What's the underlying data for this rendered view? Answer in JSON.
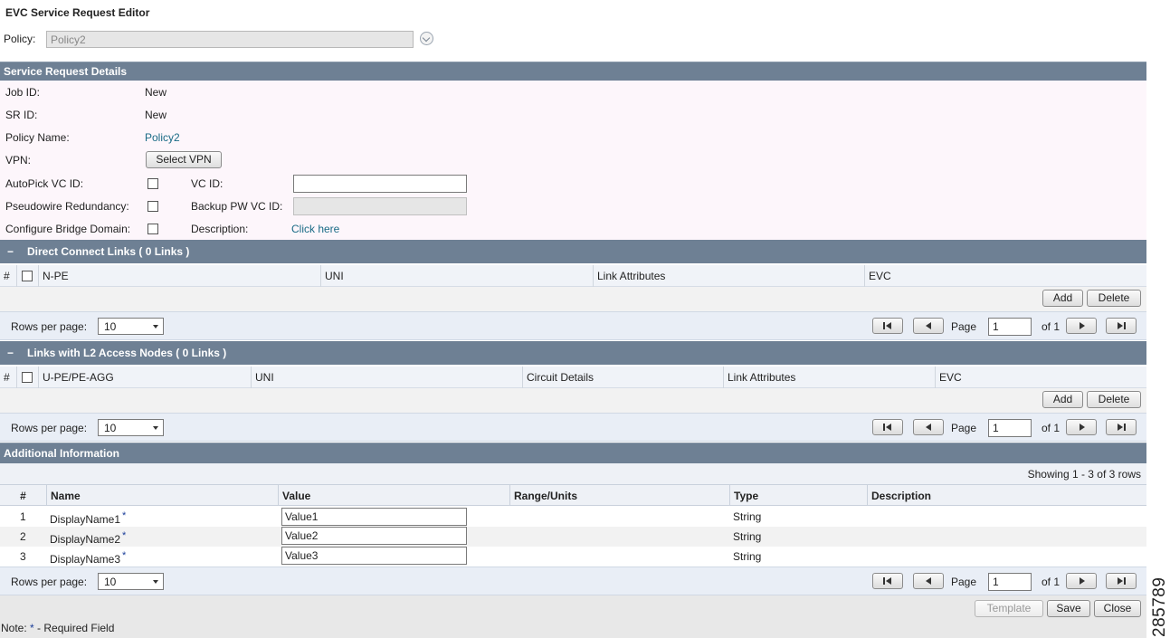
{
  "window": {
    "title": "EVC Service Request Editor"
  },
  "policy": {
    "label": "Policy:",
    "value": "Policy2"
  },
  "service_request_details": {
    "header": "Service Request Details",
    "job_id": {
      "label": "Job ID:",
      "value": "New"
    },
    "sr_id": {
      "label": "SR ID:",
      "value": "New"
    },
    "policy_name": {
      "label": "Policy Name:",
      "value": "Policy2"
    },
    "vpn": {
      "label": "VPN:",
      "button": "Select VPN"
    },
    "autopick_vc_id": {
      "label": "AutoPick VC ID:",
      "checked": false
    },
    "vc_id": {
      "label": "VC ID:",
      "value": ""
    },
    "pseudowire_redundancy": {
      "label": "Pseudowire Redundancy:",
      "checked": false
    },
    "backup_pw_vc_id": {
      "label": "Backup PW VC ID:",
      "value": ""
    },
    "configure_bridge_domain": {
      "label": "Configure Bridge Domain:",
      "checked": false
    },
    "description": {
      "label": "Description:",
      "link": "Click here"
    }
  },
  "direct_connect_links": {
    "toggle": "−",
    "header": "Direct Connect Links  ( 0 Links )",
    "columns": [
      "#",
      "N-PE",
      "UNI",
      "Link Attributes",
      "EVC"
    ],
    "add": "Add",
    "delete": "Delete"
  },
  "l2_access_links": {
    "toggle": "−",
    "header": "Links with L2 Access Nodes  ( 0 Links )",
    "columns": [
      "#",
      "U-PE/PE-AGG",
      "UNI",
      "Circuit Details",
      "Link Attributes",
      "EVC"
    ],
    "add": "Add",
    "delete": "Delete"
  },
  "pager": {
    "rows_per_page_label": "Rows per page:",
    "rows_per_page_value": "10",
    "page_label": "Page",
    "page_value": "1",
    "of_label": "of 1"
  },
  "additional_information": {
    "header": "Additional Information",
    "showing": "Showing 1 - 3 of 3 rows",
    "columns": [
      "#",
      "Name",
      "Value",
      "Range/Units",
      "Type",
      "Description"
    ],
    "rows": [
      {
        "num": "1",
        "name": "DisplayName1",
        "value": "Value1",
        "range": "",
        "type": "String",
        "description": ""
      },
      {
        "num": "2",
        "name": "DisplayName2",
        "value": "Value2",
        "range": "",
        "type": "String",
        "description": ""
      },
      {
        "num": "3",
        "name": "DisplayName3",
        "value": "Value3",
        "range": "",
        "type": "String",
        "description": ""
      }
    ],
    "required_mark": "*"
  },
  "footer": {
    "template": "Template",
    "save": "Save",
    "close": "Close",
    "note_prefix": "Note: ",
    "note_star": "*",
    "note_suffix": " - Required Field"
  },
  "figure_id": "285789",
  "colors": {
    "section_header": "#6e8094",
    "details_bg": "#fdf6fb",
    "link": "#1a6b86"
  }
}
